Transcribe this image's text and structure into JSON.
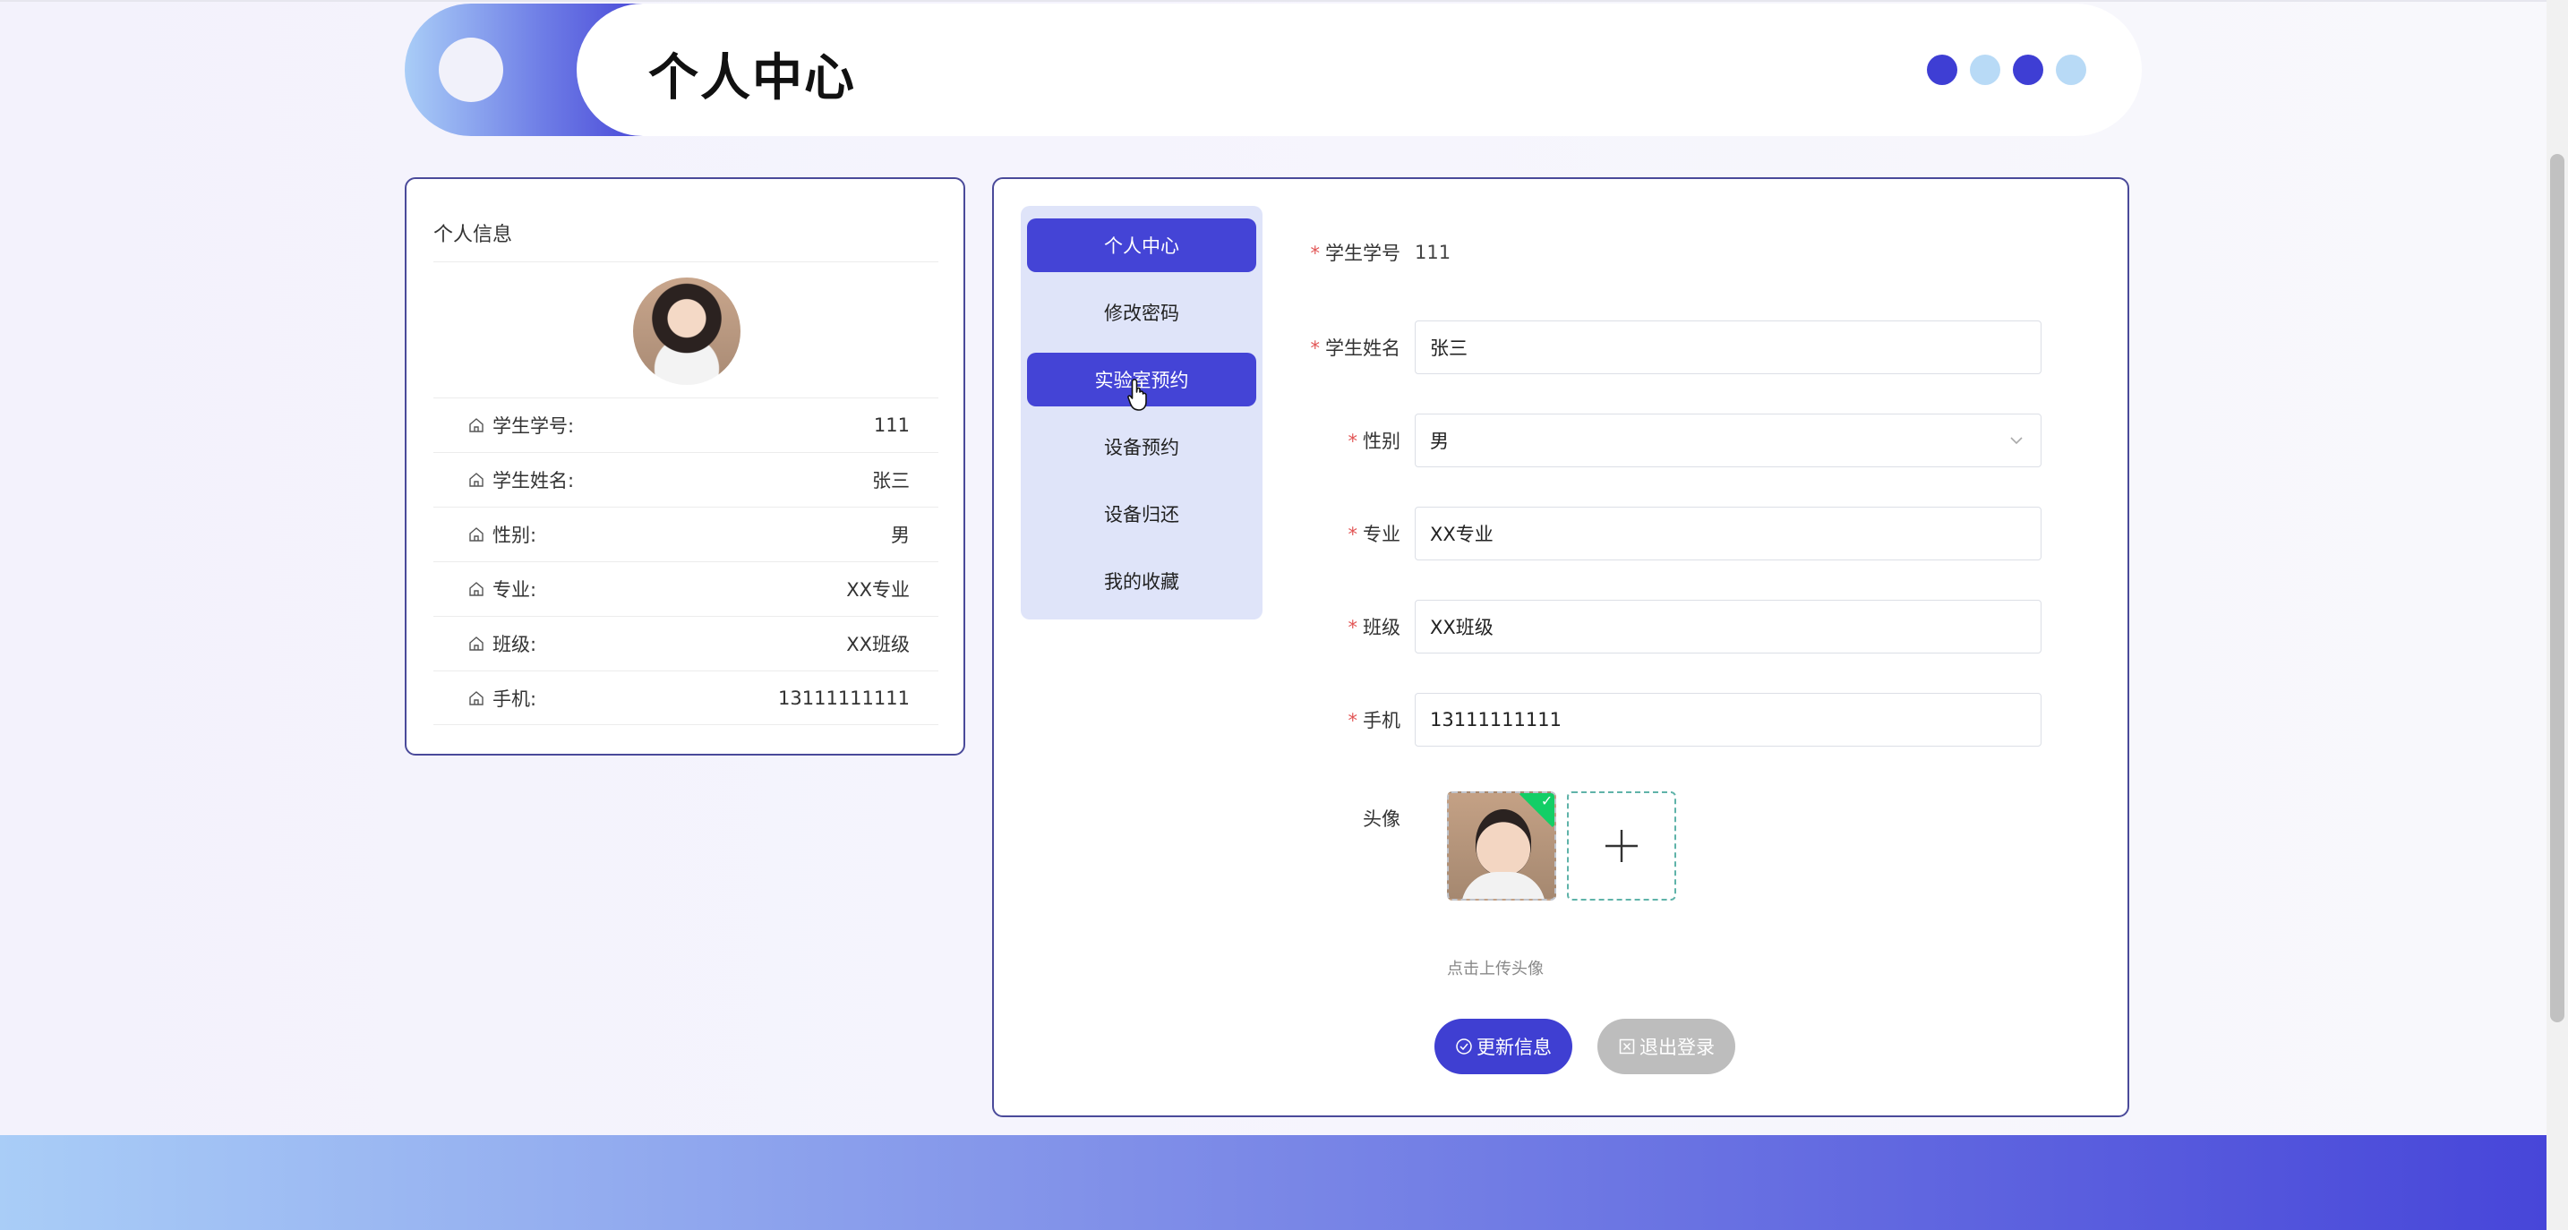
{
  "header": {
    "title": "个人中心",
    "dots": [
      "dark",
      "light",
      "dark",
      "light"
    ]
  },
  "profile": {
    "title": "个人信息",
    "fields": [
      {
        "label": "学生学号:",
        "value": "111"
      },
      {
        "label": "学生姓名:",
        "value": "张三"
      },
      {
        "label": "性别:",
        "value": "男"
      },
      {
        "label": "专业:",
        "value": "XX专业"
      },
      {
        "label": "班级:",
        "value": "XX班级"
      },
      {
        "label": "手机:",
        "value": "13111111111"
      }
    ]
  },
  "menu": {
    "items": [
      {
        "label": "个人中心",
        "active": true
      },
      {
        "label": "修改密码",
        "active": false
      },
      {
        "label": "实验室预约",
        "active": true
      },
      {
        "label": "设备预约",
        "active": false
      },
      {
        "label": "设备归还",
        "active": false
      },
      {
        "label": "我的收藏",
        "active": false
      }
    ]
  },
  "form": {
    "required_mark": "*",
    "student_id": {
      "label": "学生学号",
      "value": "111"
    },
    "student_name": {
      "label": "学生姓名",
      "value": "张三"
    },
    "gender": {
      "label": "性别",
      "value": "男"
    },
    "major": {
      "label": "专业",
      "value": "XX专业"
    },
    "class": {
      "label": "班级",
      "value": "XX班级"
    },
    "phone": {
      "label": "手机",
      "value": "13111111111"
    },
    "avatar": {
      "label": "头像",
      "hint": "点击上传头像"
    }
  },
  "buttons": {
    "update": "更新信息",
    "logout": "退出登录"
  },
  "colors": {
    "primary": "#3f3fd2",
    "menu_bg": "#dfe4f9",
    "card_border": "#4a4a9a",
    "success": "#13ce66",
    "disabled": "#bdbdbd"
  }
}
